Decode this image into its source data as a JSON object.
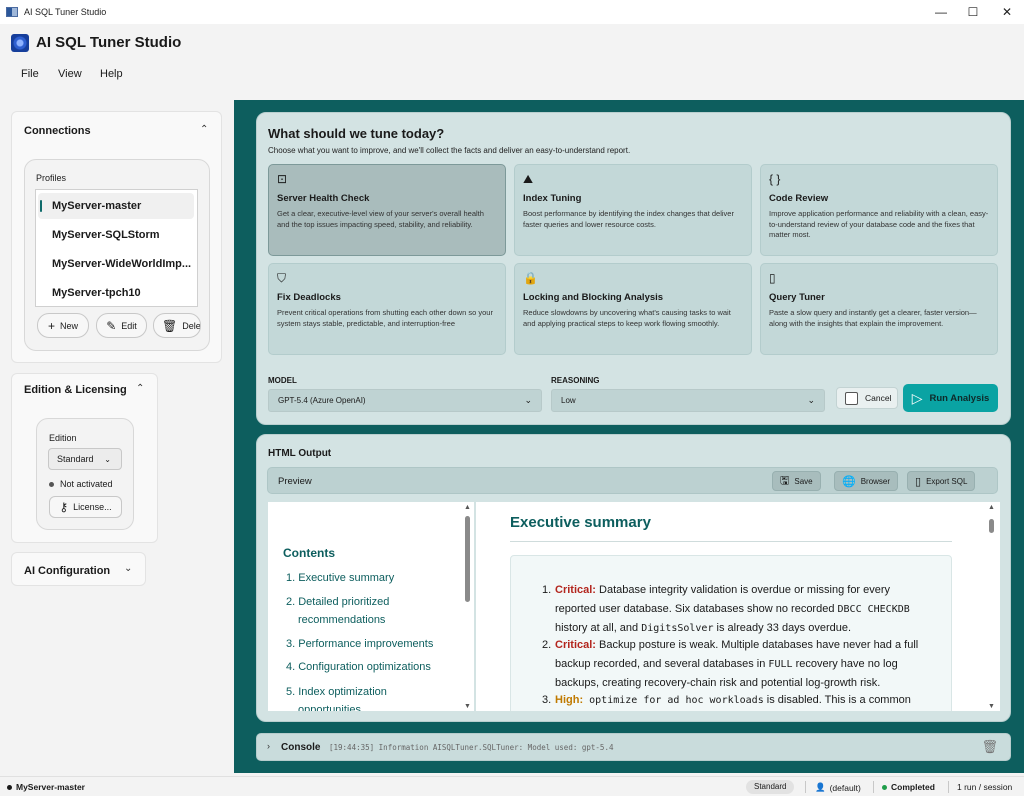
{
  "window": {
    "title": "AI SQL Tuner Studio",
    "minimize": "—",
    "maximize": "☐",
    "close": "✕"
  },
  "app": {
    "title": "AI SQL Tuner Studio"
  },
  "menu": [
    "File",
    "View",
    "Help"
  ],
  "connections": {
    "title": "Connections",
    "profiles_label": "Profiles",
    "profiles": [
      "MyServer-master",
      "MyServer-SQLStorm",
      "MyServer-WideWorldImp...",
      "MyServer-tpch10"
    ],
    "selected_index": 0,
    "buttons": {
      "new": "New",
      "edit": "Edit",
      "delete": "Dele"
    }
  },
  "edition": {
    "title": "Edition & Licensing",
    "label": "Edition",
    "value": "Standard",
    "status": "Not activated",
    "license_button": "License..."
  },
  "ai_config": {
    "title": "AI Configuration"
  },
  "tune": {
    "heading": "What should we tune today?",
    "subheading": "Choose what you want to improve, and we'll collect the facts and deliver an easy-to-understand report.",
    "tiles": [
      {
        "icon": "activity-icon",
        "title": "Server Health Check",
        "desc": "Get a clear, executive-level view of your server's overall health and the top issues impacting speed, stability, and reliability.",
        "active": true
      },
      {
        "icon": "chart-icon",
        "title": "Index Tuning",
        "desc": "Boost performance by identifying the index changes that deliver faster queries and lower resource costs.",
        "active": false
      },
      {
        "icon": "braces-icon",
        "title": "Code Review",
        "desc": "Improve application performance and reliability with a clean, easy-to-understand review of your database code and the fixes that matter most.",
        "active": false
      },
      {
        "icon": "shield-icon",
        "title": "Fix Deadlocks",
        "desc": "Prevent critical operations from shutting each other down so your system stays stable, predictable, and interruption-free",
        "active": false
      },
      {
        "icon": "lock-icon",
        "title": "Locking and Blocking Analysis",
        "desc": "Reduce slowdowns by uncovering what's causing tasks to wait and applying practical steps to keep work flowing smoothly.",
        "active": false
      },
      {
        "icon": "document-icon",
        "title": "Query Tuner",
        "desc": "Paste a slow query and instantly get a clearer, faster version—along with the insights that explain the improvement.",
        "active": false
      }
    ],
    "model_label": "MODEL",
    "model_value": "GPT-5.4 (Azure OpenAI)",
    "reasoning_label": "REASONING",
    "reasoning_value": "Low",
    "cancel_label": "Cancel",
    "run_label": "Run Analysis"
  },
  "output": {
    "heading": "HTML Output",
    "preview_label": "Preview",
    "buttons": {
      "save": "Save",
      "browser": "Browser",
      "export": "Export SQL"
    },
    "toc_title": "Contents",
    "toc": [
      "1. Executive summary",
      "2. Detailed prioritized",
      "recommendations",
      "3. Performance improvements",
      "4. Configuration optimizations",
      "5. Index optimization",
      "opportunities"
    ],
    "section_title": "Executive summary",
    "summary": [
      {
        "num": "1.",
        "severity": "Critical:",
        "line1": " Database integrity validation is overdue or missing for every",
        "line2": "reported user database. Six databases show no recorded ",
        "code1": "DBCC CHECKDB",
        "line3a": "history at all, and ",
        "code2": "DigitsSolver",
        "line3b": " is already 33 days overdue."
      },
      {
        "num": "2.",
        "severity": "Critical:",
        "line1": " Backup posture is weak. Multiple databases have never had a full",
        "line2a": "backup recorded, and several databases in ",
        "code1": "FULL",
        "line2b": " recovery have no log",
        "line3": "backups, creating recovery-chain risk and potential log-growth risk."
      },
      {
        "num": "3.",
        "severity": "High:",
        "code1": " optimize for ad hoc workloads",
        "line1": " is disabled. This is a common"
      }
    ]
  },
  "console": {
    "label": "Console",
    "log": "[19:44:35] Information AISQLTuner.SQLTuner: Model used: gpt-5.4"
  },
  "status": {
    "server": "MyServer-master",
    "edition_badge": "Standard",
    "user": "(default)",
    "state": "Completed",
    "runs": "1 run / session"
  },
  "colors": {
    "accent": "#0d5e5e",
    "run_button": "#0aa3a3",
    "critical": "#b3261e",
    "high": "#c07a00",
    "completed": "#1f9d4a"
  }
}
